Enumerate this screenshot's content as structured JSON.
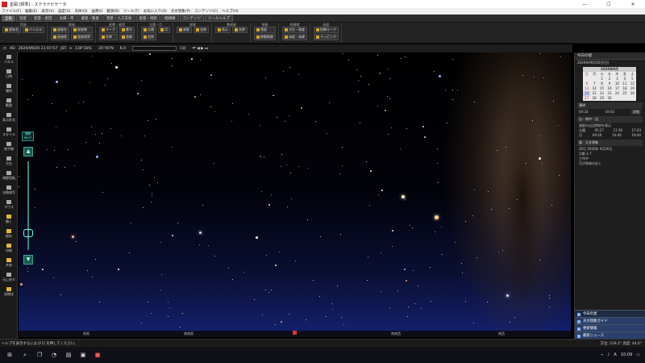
{
  "window": {
    "title": "星図 [標準] - ステラナビゲータ",
    "minimize": "—",
    "maximize": "☐",
    "close": "✕"
  },
  "menu": [
    "ファイル(F)",
    "編集(E)",
    "表示(V)",
    "設定(S)",
    "天体(O)",
    "画像(I)",
    "観測(B)",
    "ツール(T)",
    "お気に入り(A)",
    "天文現象(P)",
    "コンテンツ(C)",
    "ヘルプ(H)"
  ],
  "tabs": [
    {
      "label": "全般",
      "active": true
    },
    {
      "label": "恒星"
    },
    {
      "label": "星雲・星団"
    },
    {
      "label": "太陽・月"
    },
    {
      "label": "惑星・衛星"
    },
    {
      "label": "彗星・人工天体"
    },
    {
      "label": "星座・地形"
    },
    {
      "label": "経緯線"
    },
    {
      "label": "コンテンツ"
    },
    {
      "label": "ツールヘルプ"
    }
  ],
  "ribbon": [
    {
      "title": "恒星",
      "buttons": [
        "固有名",
        "バイエル"
      ]
    },
    {
      "title": "星座",
      "buttons": [
        "星座名",
        "星座線",
        "星座絵",
        "星座境界"
      ]
    },
    {
      "title": "星雲・星団",
      "buttons": [
        "マーク",
        "番号",
        "名称",
        "画像"
      ]
    },
    {
      "title": "太陽・月",
      "buttons": [
        "太陽",
        "月",
        "名称"
      ]
    },
    {
      "title": "惑星",
      "buttons": [
        "惑星",
        "名称"
      ]
    },
    {
      "title": "準惑星",
      "buttons": [
        "表示",
        "名称"
      ]
    },
    {
      "title": "彗星",
      "buttons": [
        "彗星",
        "移動軌跡"
      ]
    },
    {
      "title": "経緯線",
      "buttons": [
        "方位・高度",
        "赤経・赤緯"
      ]
    },
    {
      "title": "画面",
      "buttons": [
        "投稿マーク",
        "マッピング"
      ]
    }
  ],
  "status": {
    "mode": "AD",
    "datetime": "2020/09/20 21:07:57",
    "jst": "JST",
    "longitude": "139°28'E",
    "latitude": "35°45'N",
    "altitude": "6.0",
    "step": "1分"
  },
  "left_panel": [
    "パネル",
    "日時",
    "場所",
    "範囲",
    "表示形式",
    "スタイル",
    "地平線",
    "方位",
    "視野回転",
    "光跡描写",
    "マウス",
    "開く",
    "保存",
    "印刷",
    "共有",
    "元に戻す",
    "初期化"
  ],
  "zoom": {
    "label": "視野",
    "value": "90.0°",
    "up": "▲",
    "down": "▼"
  },
  "horizon": [
    "南東",
    "南南東",
    "南南西",
    "南西"
  ],
  "right_panel": {
    "title": "今日の星",
    "date_text": "2020年09月20日(日)",
    "calendar": {
      "header": "2020年9月",
      "days": [
        "日",
        "月",
        "火",
        "水",
        "木",
        "金",
        "土"
      ],
      "weeks": [
        [
          "",
          "",
          "1",
          "2",
          "3",
          "4",
          "5"
        ],
        [
          "6",
          "7",
          "8",
          "9",
          "10",
          "11",
          "12"
        ],
        [
          "13",
          "14",
          "15",
          "16",
          "17",
          "18",
          "19"
        ],
        [
          "20",
          "21",
          "22",
          "23",
          "24",
          "25",
          "26"
        ],
        [
          "27",
          "28",
          "29",
          "30",
          "",
          "",
          ""
        ]
      ],
      "selected": "20"
    },
    "twilight": {
      "head": "薄明",
      "start": "04:33",
      "end": "19:03",
      "btn": "詳細"
    },
    "rise_set_head": "出・南中・没",
    "rise_set_note": "惑星の出没時刻を表示",
    "rows": [
      {
        "name": "太陽",
        "rise": "05:27",
        "transit": "11:36",
        "set": "17:43"
      },
      {
        "name": "月",
        "rise": "09:26",
        "transit": "14:40",
        "set": "19:44"
      }
    ],
    "phenomena_head": "暦・天文現象",
    "phenomena": [
      "20日 2020年 9月20日",
      "月齢 2.7"
    ],
    "note_head": "工作中",
    "note": "月が地球の近く",
    "bottom": [
      "今日の星",
      "天文現象ガイド",
      "更新情報",
      "最新ニュース"
    ]
  },
  "statusbar": {
    "left": "ヘルプを表示するには [F1] を押してください。",
    "right": "方位: 219.2°  高度: 44.6°"
  },
  "taskbar": {
    "time": "10:09",
    "lang": "A"
  }
}
